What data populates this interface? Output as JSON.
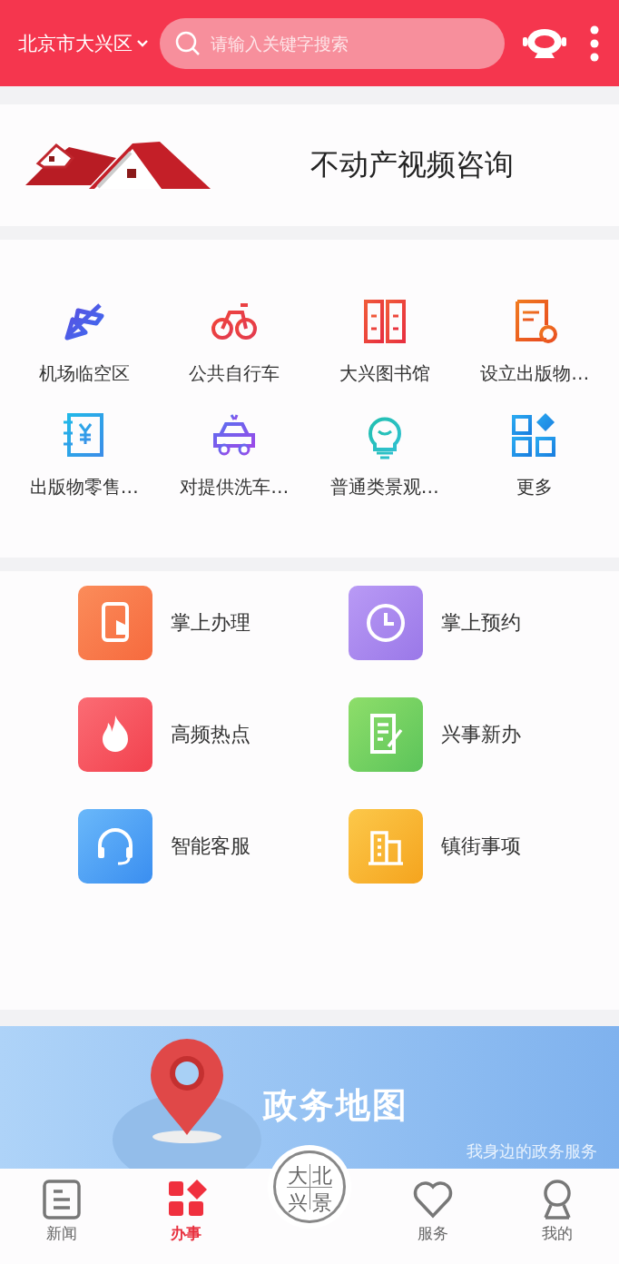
{
  "header": {
    "location": "北京市大兴区",
    "search": {
      "placeholder": "请输入关键字搜索"
    }
  },
  "promo": {
    "title": "不动产视频咨询"
  },
  "quick_grid": [
    {
      "label": "机场临空区"
    },
    {
      "label": "公共自行车"
    },
    {
      "label": "大兴图书馆"
    },
    {
      "label": "设立出版物…"
    },
    {
      "label": "出版物零售…"
    },
    {
      "label": "对提供洗车…"
    },
    {
      "label": "普通类景观…"
    },
    {
      "label": "更多"
    }
  ],
  "services": [
    {
      "label": "掌上办理"
    },
    {
      "label": "掌上预约"
    },
    {
      "label": "高频热点"
    },
    {
      "label": "兴事新办"
    },
    {
      "label": "智能客服"
    },
    {
      "label": "镇街事项"
    }
  ],
  "banner": {
    "title": "政务地图",
    "subtitle": "我身边的政务服务"
  },
  "tab_bar": [
    {
      "kind": "tab",
      "label": "新闻",
      "selected": false
    },
    {
      "kind": "tab",
      "label": "办事",
      "selected": true
    },
    {
      "kind": "logo",
      "characters": [
        "大",
        "北",
        "兴",
        "景"
      ]
    },
    {
      "kind": "tab",
      "label": "服务",
      "selected": false
    },
    {
      "kind": "tab",
      "label": "我的",
      "selected": false
    }
  ]
}
